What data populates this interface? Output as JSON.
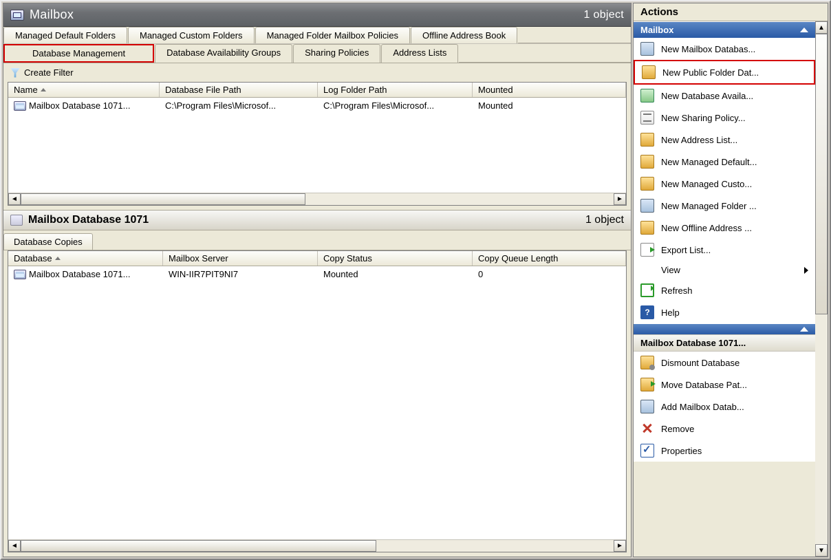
{
  "top": {
    "title": "Mailbox",
    "count": "1 object",
    "tabs_row1": [
      "Managed Default Folders",
      "Managed Custom Folders",
      "Managed Folder Mailbox Policies",
      "Offline Address Book"
    ],
    "tabs_row2": [
      "Database Management",
      "Database Availability Groups",
      "Sharing Policies",
      "Address Lists"
    ],
    "selected_tab": "Database Management",
    "filter_label": "Create Filter",
    "columns": [
      "Name",
      "Database File Path",
      "Log Folder Path",
      "Mounted"
    ],
    "rows": [
      {
        "name": "Mailbox Database 1071...",
        "path": "C:\\Program Files\\Microsof...",
        "log": "C:\\Program Files\\Microsof...",
        "mounted": "Mounted"
      }
    ]
  },
  "bottom": {
    "title": "Mailbox Database 1071",
    "count": "1 object",
    "tab": "Database Copies",
    "columns": [
      "Database",
      "Mailbox Server",
      "Copy Status",
      "Copy Queue Length"
    ],
    "rows": [
      {
        "db": "Mailbox Database 1071...",
        "server": "WIN-IIR7PIT9NI7",
        "status": "Mounted",
        "queue": "0"
      }
    ]
  },
  "actions": {
    "pane_title": "Actions",
    "section1": "Mailbox",
    "items1": [
      {
        "label": "New Mailbox Databas...",
        "icon": "db"
      },
      {
        "label": "New Public Folder Dat...",
        "icon": "folder",
        "highlight": true
      },
      {
        "label": "New Database Availa...",
        "icon": "group"
      },
      {
        "label": "New Sharing Policy...",
        "icon": "policy"
      },
      {
        "label": "New Address List...",
        "icon": "addr"
      },
      {
        "label": "New Managed Default...",
        "icon": "folder"
      },
      {
        "label": "New Managed Custo...",
        "icon": "folder"
      },
      {
        "label": "New Managed Folder ...",
        "icon": "db"
      },
      {
        "label": "New Offline Address ...",
        "icon": "addr"
      },
      {
        "label": "Export List...",
        "icon": "export"
      },
      {
        "label": "View",
        "icon": "",
        "submenu": true
      },
      {
        "label": "Refresh",
        "icon": "refresh"
      },
      {
        "label": "Help",
        "icon": "help"
      }
    ],
    "section2": "Mailbox Database 1071...",
    "items2": [
      {
        "label": "Dismount Database",
        "icon": "dismount"
      },
      {
        "label": "Move Database Pat...",
        "icon": "move"
      },
      {
        "label": "Add Mailbox Datab...",
        "icon": "db"
      },
      {
        "label": "Remove",
        "icon": "remove"
      },
      {
        "label": "Properties",
        "icon": "prop"
      }
    ]
  }
}
